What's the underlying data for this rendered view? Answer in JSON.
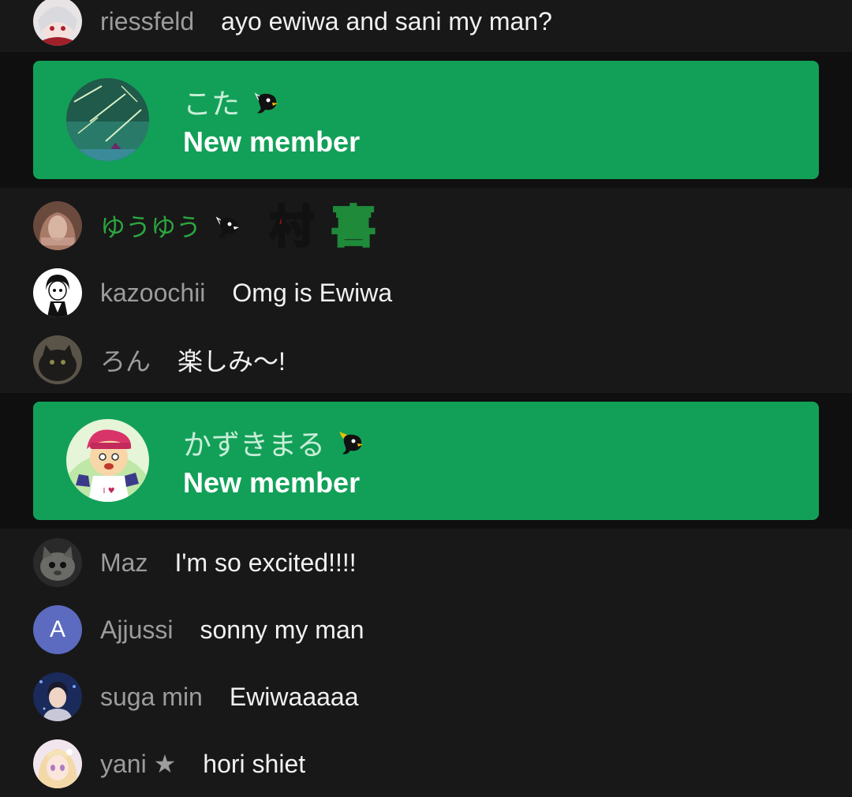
{
  "messages": [
    {
      "author": "riessfeld",
      "text": "ayo ewiwa and sani my man?"
    },
    {
      "author": "ゆうゆう",
      "text": "",
      "member": true,
      "emojis": [
        "mura-emoji",
        "ki-emoji"
      ]
    },
    {
      "author": "kazoochii",
      "text": "Omg is Ewiwa"
    },
    {
      "author": "ろん",
      "text": "楽しみ〜!"
    },
    {
      "author": "Maz",
      "text": "I'm so excited!!!!"
    },
    {
      "author": "Ajjussi",
      "text": "sonny my man",
      "avatar_letter": "A"
    },
    {
      "author": "suga min",
      "text": "Ewiwaaaaa"
    },
    {
      "author": "yani ★",
      "text": "hori shiet"
    }
  ],
  "memberships": [
    {
      "name": "こた",
      "title": "New member"
    },
    {
      "name": "かずきまる",
      "title": "New member"
    }
  ],
  "colors": {
    "background": "#181818",
    "band": "#0f0f0f",
    "membership_card": "#12a058",
    "member_name": "#2ba640",
    "author": "#9c9c9c",
    "message": "#f1f1f1",
    "letter_avatar": "#5c6bc0"
  },
  "icons": {
    "member_badge": "bird-badge-icon"
  }
}
